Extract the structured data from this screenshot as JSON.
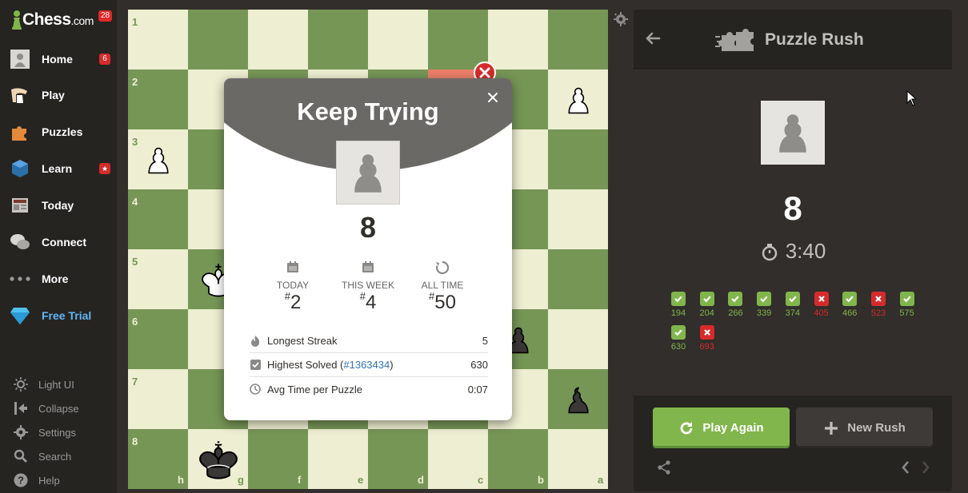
{
  "app": {
    "logo": {
      "name": "Chess",
      "suffix": ".com",
      "badge": "28"
    }
  },
  "sidebar": {
    "items": [
      {
        "label": "Home",
        "badge": "6",
        "icon": "avatar-icon"
      },
      {
        "label": "Play",
        "badge": "",
        "icon": "play-hand-icon"
      },
      {
        "label": "Puzzles",
        "badge": "",
        "icon": "puzzle-piece-icon"
      },
      {
        "label": "Learn",
        "badge": "★",
        "icon": "learn-cube-icon"
      },
      {
        "label": "Today",
        "badge": "",
        "icon": "newspaper-icon"
      },
      {
        "label": "Connect",
        "badge": "",
        "icon": "chat-bubbles-icon"
      },
      {
        "label": "More",
        "badge": "",
        "icon": "more-dots-icon"
      },
      {
        "label": "Free Trial",
        "badge": "",
        "icon": "diamond-icon"
      }
    ],
    "bottom": [
      {
        "label": "Light UI",
        "icon": "sun-icon"
      },
      {
        "label": "Collapse",
        "icon": "collapse-icon"
      },
      {
        "label": "Settings",
        "icon": "gear-icon"
      },
      {
        "label": "Search",
        "icon": "search-icon"
      },
      {
        "label": "Help",
        "icon": "help-icon"
      }
    ]
  },
  "board": {
    "ranks": [
      "1",
      "2",
      "3",
      "4",
      "5",
      "6",
      "7",
      "8"
    ],
    "files": [
      "h",
      "g",
      "f",
      "e",
      "d",
      "c",
      "b",
      "a"
    ],
    "light_color": "#eeeed2",
    "dark_color": "#769656"
  },
  "modal": {
    "title": "Keep Trying",
    "score": "8",
    "ranks": [
      {
        "label": "TODAY",
        "hash": "#",
        "value": "2"
      },
      {
        "label": "THIS WEEK",
        "hash": "#",
        "value": "4"
      },
      {
        "label": "ALL TIME",
        "hash": "#",
        "value": "50"
      }
    ],
    "stats": [
      {
        "label": "Longest Streak",
        "value": "5"
      },
      {
        "label": "Highest Solved (",
        "link": "#1363434",
        "label_end": ")",
        "value": "630"
      },
      {
        "label": "Avg Time per Puzzle",
        "value": "0:07"
      }
    ]
  },
  "panel": {
    "title": "Puzzle Rush",
    "score": "8",
    "timer": "3:40",
    "results": [
      {
        "value": "194",
        "ok": true
      },
      {
        "value": "204",
        "ok": true
      },
      {
        "value": "266",
        "ok": true
      },
      {
        "value": "339",
        "ok": true
      },
      {
        "value": "374",
        "ok": true
      },
      {
        "value": "405",
        "ok": false
      },
      {
        "value": "466",
        "ok": true
      },
      {
        "value": "523",
        "ok": false
      },
      {
        "value": "575",
        "ok": true
      },
      {
        "value": "630",
        "ok": true
      },
      {
        "value": "693",
        "ok": false
      }
    ],
    "play_again": "Play Again",
    "new_rush": "New Rush",
    "colors": {
      "correct": "#81b64c",
      "wrong": "#d62b2b"
    }
  }
}
